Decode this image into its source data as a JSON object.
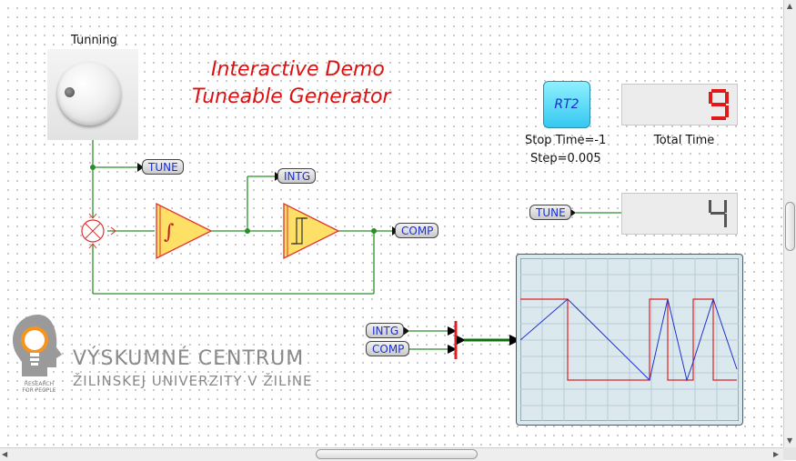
{
  "title_line1": "Interactive Demo",
  "title_line2": "Tuneable Generator",
  "knob": {
    "label": "Tunning"
  },
  "tags": {
    "tune": "TUNE",
    "intg": "INTG",
    "comp": "COMP"
  },
  "clock": {
    "label": "RT2",
    "stop_time": "Stop Time=-1",
    "step": "Step=0.005"
  },
  "total_time": {
    "label": "Total Time",
    "value": "9"
  },
  "tune_display": {
    "value": "4"
  },
  "logo": {
    "line1": "VÝSKUMNÉ CENTRUM",
    "line2": "ŽILINSKEJ UNIVERZITY V ŽILINE",
    "small1": "RESEARCH",
    "small2": "FOR PEOPLE"
  },
  "colors": {
    "title": "#e01010",
    "wire": "#2a8f2a",
    "block": "#ffe066",
    "block_border": "#e03030",
    "tag_text": "#1a2fd8",
    "scope_red": "#e02020",
    "scope_blue": "#2030d0"
  },
  "icons": {
    "knob": "rotary-knob-icon",
    "sum": "sum-junction-icon",
    "integrator": "integrator-icon",
    "hysteresis": "relay-hysteresis-icon",
    "mux": "mux-icon",
    "logo": "lightbulb-head-icon"
  }
}
